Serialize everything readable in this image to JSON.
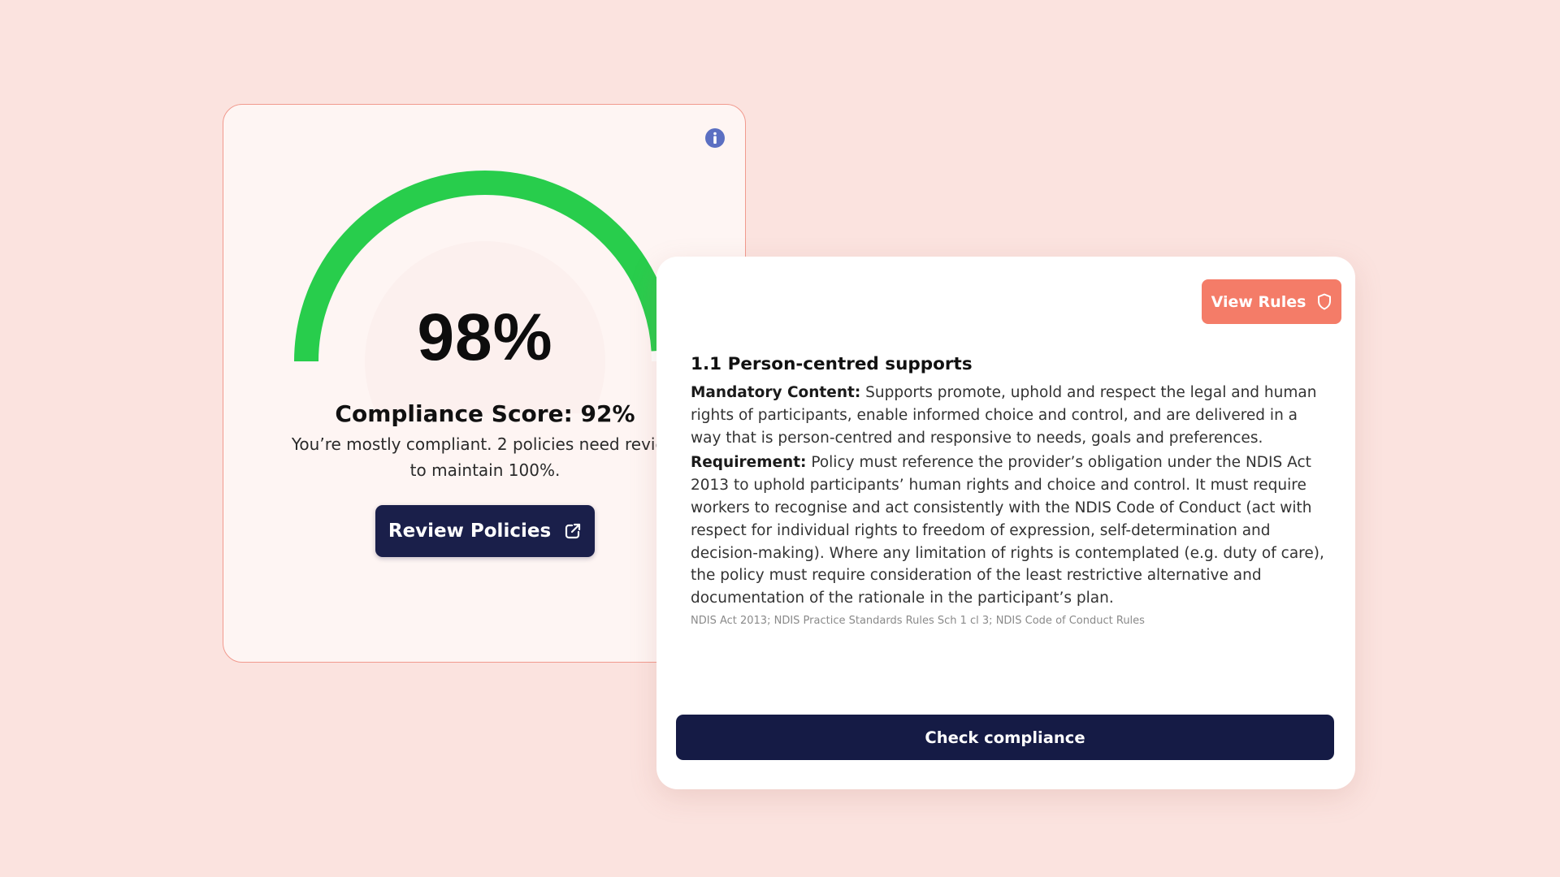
{
  "score_card": {
    "gauge_percent": 98,
    "gauge_value_label": "98%",
    "title": "Compliance Score: 92%",
    "description": "You’re mostly compliant. 2 policies need review to maintain 100%.",
    "review_button_label": "Review Policies",
    "info_icon": "info-icon",
    "review_button_icon": "external-link-icon"
  },
  "rule_card": {
    "view_rules_label": "View Rules",
    "view_rules_icon": "shield-icon",
    "heading": "1.1 Person-centred supports",
    "mandatory_label": "Mandatory Content:",
    "mandatory_text": " Supports promote, uphold and respect the legal and human rights of participants, enable informed choice and control, and are delivered in a way that is person-centred and responsive to needs, goals and preferences.",
    "requirement_label": "Requirement:",
    "requirement_text": " Policy must reference the provider’s obligation under the NDIS Act 2013 to uphold participants’ human rights and choice and control. It must require workers to recognise and act consistently with the NDIS Code of Conduct (act with respect for individual rights to freedom of expression, self-determination and decision-making). Where any limitation of rights is contemplated (e.g. duty of care), the policy must require consideration of the least restrictive alternative and documentation of the rationale in the participant’s plan.",
    "sources": "NDIS Act 2013; NDIS Practice Standards Rules Sch 1 cl 3; NDIS Code of Conduct Rules",
    "check_button_label": "Check compliance"
  },
  "colors": {
    "background": "#fbe3df",
    "gauge_green": "#28cd4c",
    "navy": "#1a1f4a",
    "accent_coral": "#f47c68",
    "info_blue": "#5b6fc2"
  }
}
